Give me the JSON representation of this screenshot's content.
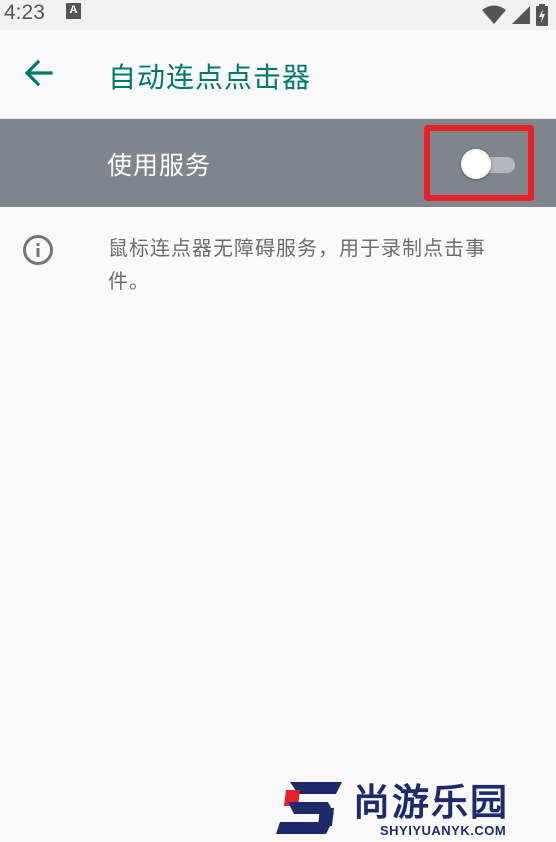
{
  "status_bar": {
    "time": "4:23",
    "notification_icon_letter": "A",
    "icons": [
      "wifi-icon",
      "signal-icon",
      "battery-charging-icon"
    ]
  },
  "app_bar": {
    "back_icon": "arrow-left-icon",
    "title": "自动连点点击器"
  },
  "service": {
    "label": "使用服务",
    "switch_on": false,
    "highlight_color": "#e8202a"
  },
  "info": {
    "icon": "info-icon",
    "text": "鼠标连点器无障碍服务，用于录制点击事件。"
  },
  "watermark": {
    "brand": "尚游乐园",
    "url": "SHYIYUANYK.COM"
  },
  "colors": {
    "accent": "#00796b",
    "service_row_bg": "#80868b",
    "page_bg": "#fafafa"
  }
}
